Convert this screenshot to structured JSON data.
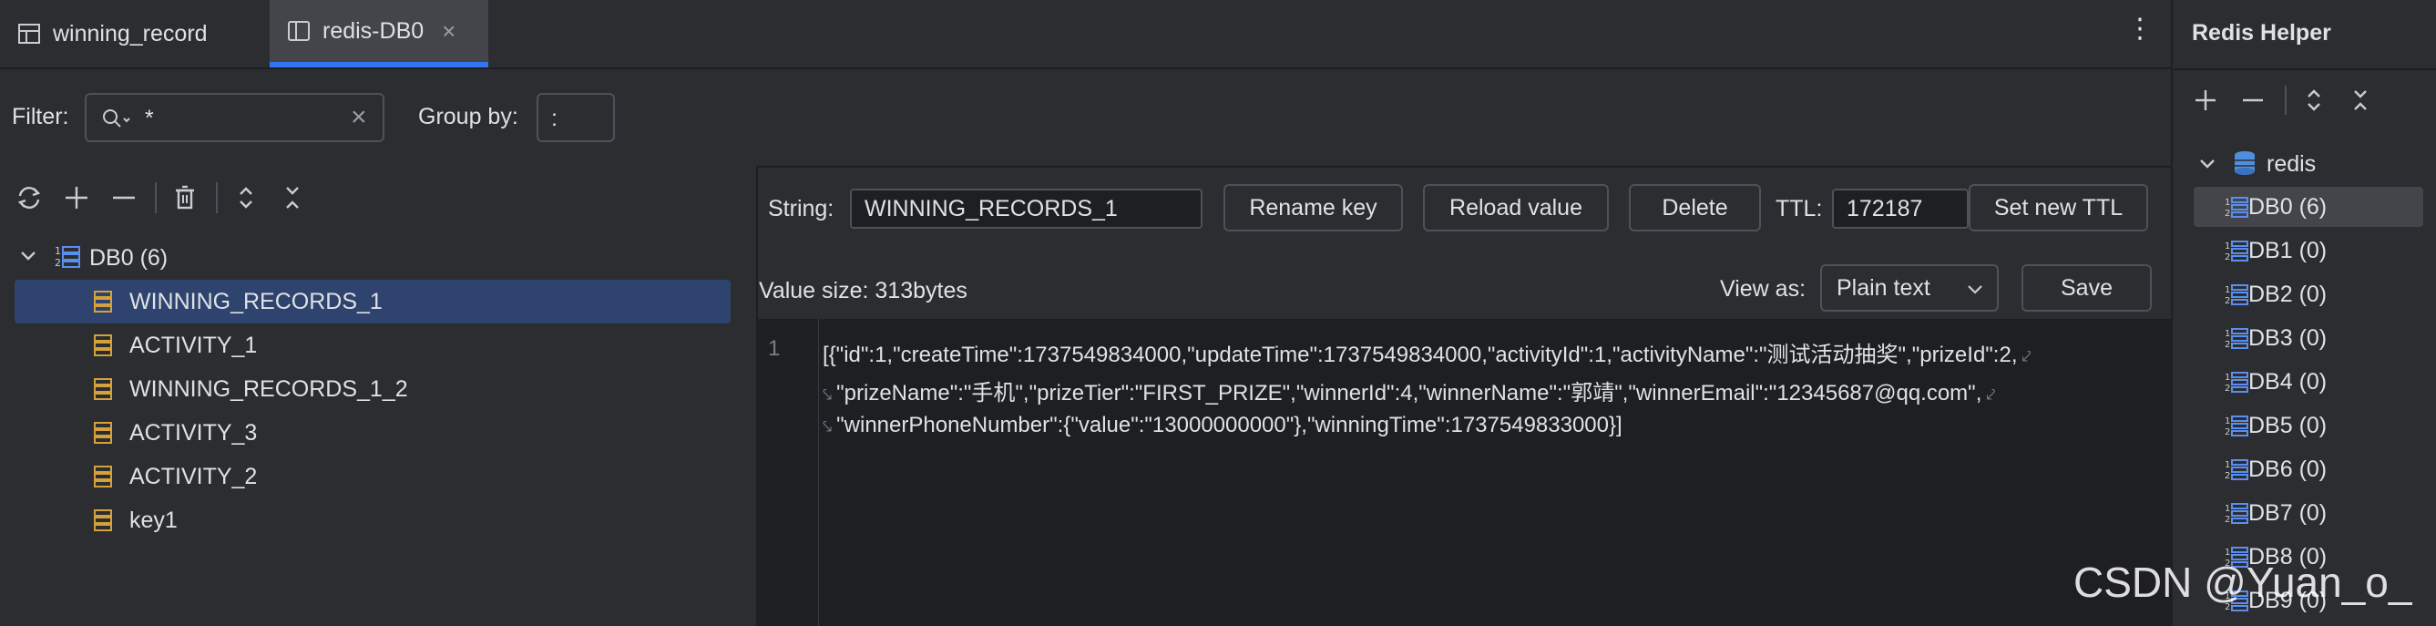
{
  "tabs": [
    {
      "label": "winning_record",
      "icon": "table-icon"
    },
    {
      "label": "redis-DB0",
      "icon": "panel-icon",
      "close": "×"
    }
  ],
  "menu_glyph": "⋮",
  "filter": {
    "label": "Filter:",
    "value": "*",
    "clear": "×",
    "group_label": "Group by:",
    "group_value": ":"
  },
  "tree": {
    "db": "DB0 (6)",
    "keys": [
      "WINNING_RECORDS_1",
      "ACTIVITY_1",
      "WINNING_RECORDS_1_2",
      "ACTIVITY_3",
      "ACTIVITY_2",
      "key1"
    ]
  },
  "editor": {
    "type_label": "String:",
    "key_name": "WINNING_RECORDS_1",
    "rename": "Rename key",
    "reload": "Reload value",
    "delete": "Delete",
    "ttl_label": "TTL:",
    "ttl_value": "172187",
    "set_ttl": "Set new TTL",
    "value_size": "Value size: 313bytes",
    "view_as_label": "View as:",
    "view_as_value": "Plain text",
    "save": "Save",
    "line_number": "1",
    "lines": [
      "[{\"id\":1,\"createTime\":1737549834000,\"updateTime\":1737549834000,\"activityId\":1,\"activityName\":\"测试活动抽奖\",\"prizeId\":2,",
      "\"prizeName\":\"手机\",\"prizeTier\":\"FIRST_PRIZE\",\"winnerId\":4,\"winnerName\":\"郭靖\",\"winnerEmail\":\"12345687@qq.com\",",
      "\"winnerPhoneNumber\":{\"value\":\"13000000000\"},\"winningTime\":1737549833000}]"
    ]
  },
  "sidebar": {
    "title": "Redis Helper",
    "root": "redis",
    "dbs": [
      "DB0 (6)",
      "DB1 (0)",
      "DB2 (0)",
      "DB3 (0)",
      "DB4 (0)",
      "DB5 (0)",
      "DB6 (0)",
      "DB7 (0)",
      "DB8 (0)",
      "DB9 (0)"
    ]
  },
  "watermark": "CSDN @Yuan_o_",
  "colors": {
    "accent": "#3574f0",
    "key_icon": "#d5a13a",
    "db_icon": "#5a8ff0",
    "selection": "#2e436e"
  }
}
